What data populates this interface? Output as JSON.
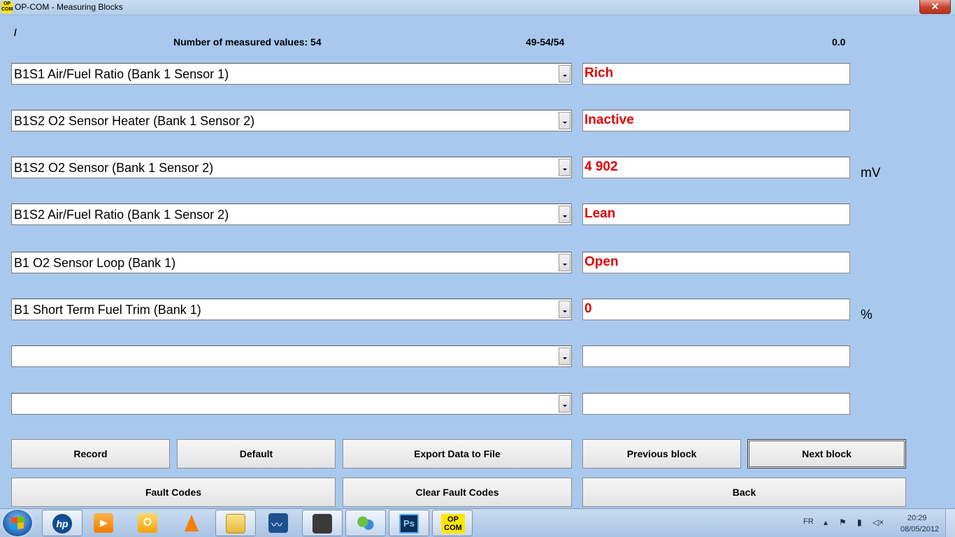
{
  "window": {
    "title": "OP-COM - Measuring Blocks",
    "app_icon_top": "OP",
    "app_icon_bottom": "COM",
    "close_label": "✕"
  },
  "header": {
    "slash": "/",
    "count_label": "Number of measured values: 54",
    "range": "49-54/54",
    "value": "0.0"
  },
  "rows": [
    {
      "param": "B1S1 Air/Fuel Ratio (Bank 1 Sensor 1)",
      "value": "Rich",
      "unit": ""
    },
    {
      "param": "B1S2 O2 Sensor Heater (Bank 1 Sensor 2)",
      "value": "Inactive",
      "unit": ""
    },
    {
      "param": "B1S2 O2 Sensor (Bank 1 Sensor 2)",
      "value": "4 902",
      "unit": "mV"
    },
    {
      "param": "B1S2 Air/Fuel Ratio (Bank 1 Sensor 2)",
      "value": "Lean",
      "unit": ""
    },
    {
      "param": "B1 O2 Sensor Loop (Bank 1)",
      "value": "Open",
      "unit": ""
    },
    {
      "param": "B1 Short Term Fuel Trim (Bank 1)",
      "value": "0",
      "unit": "%"
    },
    {
      "param": "",
      "value": "",
      "unit": ""
    },
    {
      "param": "",
      "value": "",
      "unit": ""
    }
  ],
  "buttons": {
    "record": "Record",
    "default": "Default",
    "export": "Export Data to File",
    "previous": "Previous block",
    "next": "Next block",
    "fault_codes": "Fault Codes",
    "clear_fault_codes": "Clear Fault Codes",
    "back": "Back"
  },
  "taskbar": {
    "items": [
      "start-orb",
      "hp-icon",
      "media-center-icon",
      "outlook-icon",
      "vlc-icon",
      "file-explorer-icon",
      "chart-app-icon",
      "device-icon",
      "messenger-icon",
      "photoshop-icon",
      "opcom-icon"
    ],
    "hp_label": "hp",
    "outlook_label": "O",
    "ps_label": "Ps",
    "opcom_top": "OP",
    "opcom_bottom": "COM"
  },
  "tray": {
    "language": "FR",
    "time": "20:29",
    "date": "08/05/2012"
  },
  "colors": {
    "background": "#a9c8ee",
    "value_text": "#e00000"
  }
}
